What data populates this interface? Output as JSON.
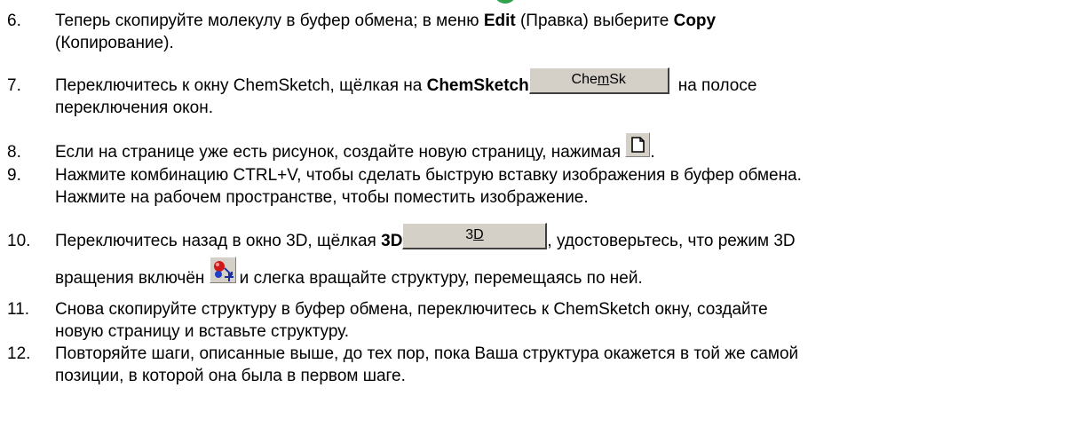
{
  "steps": [
    {
      "num": "6.",
      "l1a": "Теперь скопируйте молекулу в буфер обмена; в меню ",
      "l1b": "Edit",
      "l1c": " (Правка) выберите ",
      "l1d": "Copy",
      "l2": "(Копирование)."
    },
    {
      "num": "7.",
      "l1a": "Переключитесь к окну ChemSketch, щёлкая на ",
      "l1b": "ChemSketch",
      "btn_pre": "Che",
      "btn_ul": "m",
      "btn_post": "Sk",
      "l1c": "на полосе",
      "l2": "переключения окон."
    },
    {
      "num": "8.",
      "l1": "Если на странице уже есть рисунок, создайте новую страницу, нажимая",
      "icon": "new-page-icon",
      "end": "."
    },
    {
      "num": "9.",
      "l1": "Нажмите комбинацию CTRL+V, чтобы сделать быструю вставку изображения в буфер обмена.",
      "l2": "Нажмите на рабочем пространстве, чтобы поместить изображение."
    },
    {
      "num": "10.",
      "l1a": "Переключитесь назад в окно 3D, щёлкая ",
      "l1b": "3D",
      "btn_pre": "3",
      "btn_ul": "D",
      "l1c": ", удостоверьтесь, что режим 3D",
      "l2a": "вращения включён",
      "icon": "3d-rotation-icon",
      "l2b": "и слегка вращайте структуру, перемещаясь по ней."
    },
    {
      "num": "11.",
      "l1": "Снова скопируйте структуру в буфер обмена, переключитесь к ChemSketch окну, создайте",
      "l2": "новую страницу и вставьте структуру."
    },
    {
      "num": "12.",
      "l1": "Повторяйте шаги, описанные выше, до тех пор, пока Ваша структура окажется в той же самой",
      "l2": "позиции, в которой она была в первом шаге."
    }
  ]
}
